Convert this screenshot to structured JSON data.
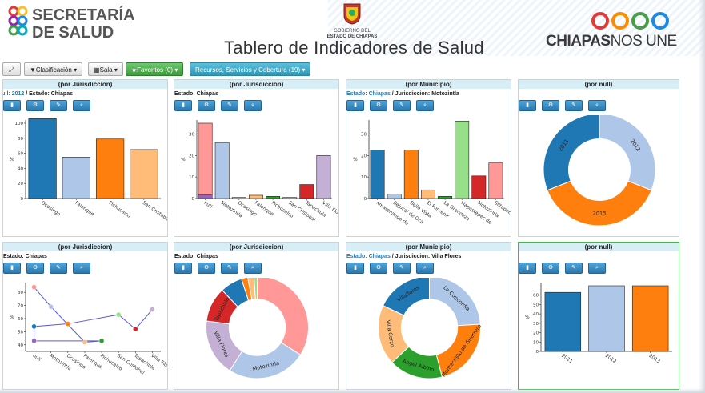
{
  "header": {
    "logo_left_line1": "SECRETARÍA",
    "logo_left_line2": "DE SALUD",
    "crest_line1": "GOBIERNO DEL",
    "crest_line2": "ESTADO DE CHIAPAS",
    "title": "Tablero de Indicadores de Salud",
    "logo_right_bold": "CHIAPAS",
    "logo_right_thin": "NOS UNE"
  },
  "colors": {
    "blue": "#1f77b4",
    "light_blue": "#aec7e8",
    "orange": "#ff7f0e",
    "light_orange": "#ffbb78",
    "green": "#2ca02c",
    "light_green": "#98df8a",
    "red": "#d62728",
    "pink": "#ff9896",
    "purple": "#9467bd",
    "lavender": "#c5b0d5",
    "brown": "#8c564b",
    "light_brown": "#c49c94"
  },
  "toolbar": {
    "expand_icon": "resize-icon",
    "clasificacion": "Clasificación",
    "sala": "Sala",
    "favoritos": "Favoritos (0)",
    "recursos": "Recursos, Servicios y Cobertura (19)"
  },
  "icons": [
    "bar-chart-icon",
    "gear-icon",
    "edit-icon",
    "zoom-icon"
  ],
  "panels": [
    {
      "id": "p1",
      "head": "(por Jurisdiccion)",
      "sub_link": "null: 2012",
      "sub_rest": " / Estado: Chiapas",
      "chart_data": {
        "type": "bar",
        "ylabel": "%",
        "ylim": [
          0,
          100
        ],
        "yticks": [
          0,
          20,
          40,
          60,
          80,
          100
        ],
        "categories": [
          "Ocosingo",
          "Palenque",
          "Pichucalco",
          "San Cristobal"
        ],
        "values": [
          109,
          55,
          79,
          65
        ],
        "colors": [
          "#1f77b4",
          "#aec7e8",
          "#ff7f0e",
          "#ffbb78"
        ]
      }
    },
    {
      "id": "p2",
      "head": "(por Jurisdiccion)",
      "sub_link": "",
      "sub_rest": "Estado: Chiapas",
      "chart_data": {
        "type": "bar",
        "ylabel": "%",
        "ylim": [
          0,
          35
        ],
        "yticks": [
          0,
          10,
          20,
          30
        ],
        "categories": [
          "null",
          "Motozintla",
          "Ocosingo",
          "Palenque",
          "Pichucalco",
          "San Cristobal",
          "Tapachula",
          "Villa Flores"
        ],
        "values": [
          35,
          26,
          0.5,
          1.5,
          1,
          0.5,
          6.5,
          20
        ],
        "stacked_base": [
          1.7,
          0,
          0,
          0,
          0,
          0,
          0,
          0
        ],
        "colors": [
          "#ff9896",
          "#aec7e8",
          "#ffbb78",
          "#ffbb78",
          "#2ca02c",
          "#98df8a",
          "#d62728",
          "#c5b0d5"
        ],
        "base_colors": [
          "#9467bd",
          "#aec7e8",
          "#aec7e8",
          "#aec7e8",
          "#aec7e8",
          "#aec7e8",
          "#aec7e8",
          "#aec7e8"
        ]
      }
    },
    {
      "id": "p3",
      "head": "(por Municipio)",
      "sub_link": "Estado: Chiapas",
      "sub_rest": " / Jurisdiccion: Motozintla",
      "chart_data": {
        "type": "bar",
        "ylabel": "%",
        "ylim": [
          0,
          35
        ],
        "yticks": [
          0,
          10,
          20,
          30
        ],
        "categories": [
          "Amatenango de",
          "Bejucal de Oca",
          "Bella Vista",
          "El Porvenir",
          "La Grandeza",
          "Mapastepec de",
          "Motozintla",
          "Siltepec"
        ],
        "values": [
          22.5,
          2,
          22.5,
          4,
          1,
          36,
          10.5,
          16.5
        ],
        "colors": [
          "#1f77b4",
          "#aec7e8",
          "#ff7f0e",
          "#ffbb78",
          "#2ca02c",
          "#98df8a",
          "#d62728",
          "#ff9896"
        ]
      }
    },
    {
      "id": "p4",
      "head": "(por null)",
      "sub_link": "",
      "sub_rest": "",
      "chart_data": {
        "type": "pie",
        "donut": true,
        "labels": [
          "2012",
          "2013",
          "2011"
        ],
        "values": [
          31,
          38,
          31
        ],
        "colors": [
          "#aec7e8",
          "#ff7f0e",
          "#1f77b4"
        ]
      }
    },
    {
      "id": "p5",
      "head": "(por Jurisdiccion)",
      "sub_link": "",
      "sub_rest": "Estado: Chiapas",
      "chart_data": {
        "type": "line",
        "ylabel": "%",
        "ylim": [
          35,
          85
        ],
        "yticks": [
          40,
          50,
          60,
          70,
          80
        ],
        "categories": [
          "null",
          "Motozintla",
          "Ocosingo",
          "Palenque",
          "Pichucalco",
          "San Cristobal",
          "Tapachula",
          "Villa Flores"
        ],
        "points": [
          {
            "cat": 0,
            "y": 84,
            "color": "#ff9896"
          },
          {
            "cat": 0,
            "y": 54,
            "color": "#1f77b4"
          },
          {
            "cat": 0,
            "y": 43,
            "color": "#9467bd"
          },
          {
            "cat": 1,
            "y": 69,
            "color": "#aec7e8"
          },
          {
            "cat": 2,
            "y": 56,
            "color": "#ff7f0e"
          },
          {
            "cat": 3,
            "y": 42,
            "color": "#ffbb78"
          },
          {
            "cat": 4,
            "y": 43,
            "color": "#2ca02c"
          },
          {
            "cat": 5,
            "y": 63,
            "color": "#98df8a"
          },
          {
            "cat": 6,
            "y": 52,
            "color": "#d62728"
          },
          {
            "cat": 7,
            "y": 67,
            "color": "#c5b0d5"
          }
        ]
      }
    },
    {
      "id": "p6",
      "head": "(por Jurisdiccion)",
      "sub_link": "",
      "sub_rest": "Estado: Chiapas",
      "chart_data": {
        "type": "pie",
        "donut": true,
        "labels": [
          "",
          "Motozintla",
          "Villa Flores",
          "Tapachula",
          "",
          "",
          "",
          ""
        ],
        "values": [
          34,
          25,
          18,
          11,
          7,
          2,
          2,
          1
        ],
        "colors": [
          "#ff9896",
          "#aec7e8",
          "#c5b0d5",
          "#d62728",
          "#1f77b4",
          "#ff7f0e",
          "#ffbb78",
          "#98df8a"
        ]
      }
    },
    {
      "id": "p7",
      "head": "(por Municipio)",
      "sub_link": "Estado: Chiapas",
      "sub_rest": " / Jurisdiccion: Villa Flores",
      "chart_data": {
        "type": "pie",
        "donut": true,
        "labels": [
          "La Concordia",
          "Montecristo de Guerrero",
          "Ángel Albino",
          "Villa Corzo",
          "Villaflores"
        ],
        "values": [
          24,
          22,
          17,
          19,
          18
        ],
        "colors": [
          "#aec7e8",
          "#ff7f0e",
          "#2ca02c",
          "#ffbb78",
          "#1f77b4"
        ]
      }
    },
    {
      "id": "p8",
      "head": "(por null)",
      "sub_link": "",
      "sub_rest": "",
      "chart_data": {
        "type": "bar",
        "ylabel": "%",
        "ylim": [
          0,
          70
        ],
        "yticks": [
          0,
          10,
          20,
          30,
          40,
          50,
          60
        ],
        "categories": [
          "2011",
          "2012",
          "2013"
        ],
        "values": [
          63,
          70,
          70
        ],
        "colors": [
          "#1f77b4",
          "#aec7e8",
          "#ff7f0e"
        ]
      }
    }
  ]
}
